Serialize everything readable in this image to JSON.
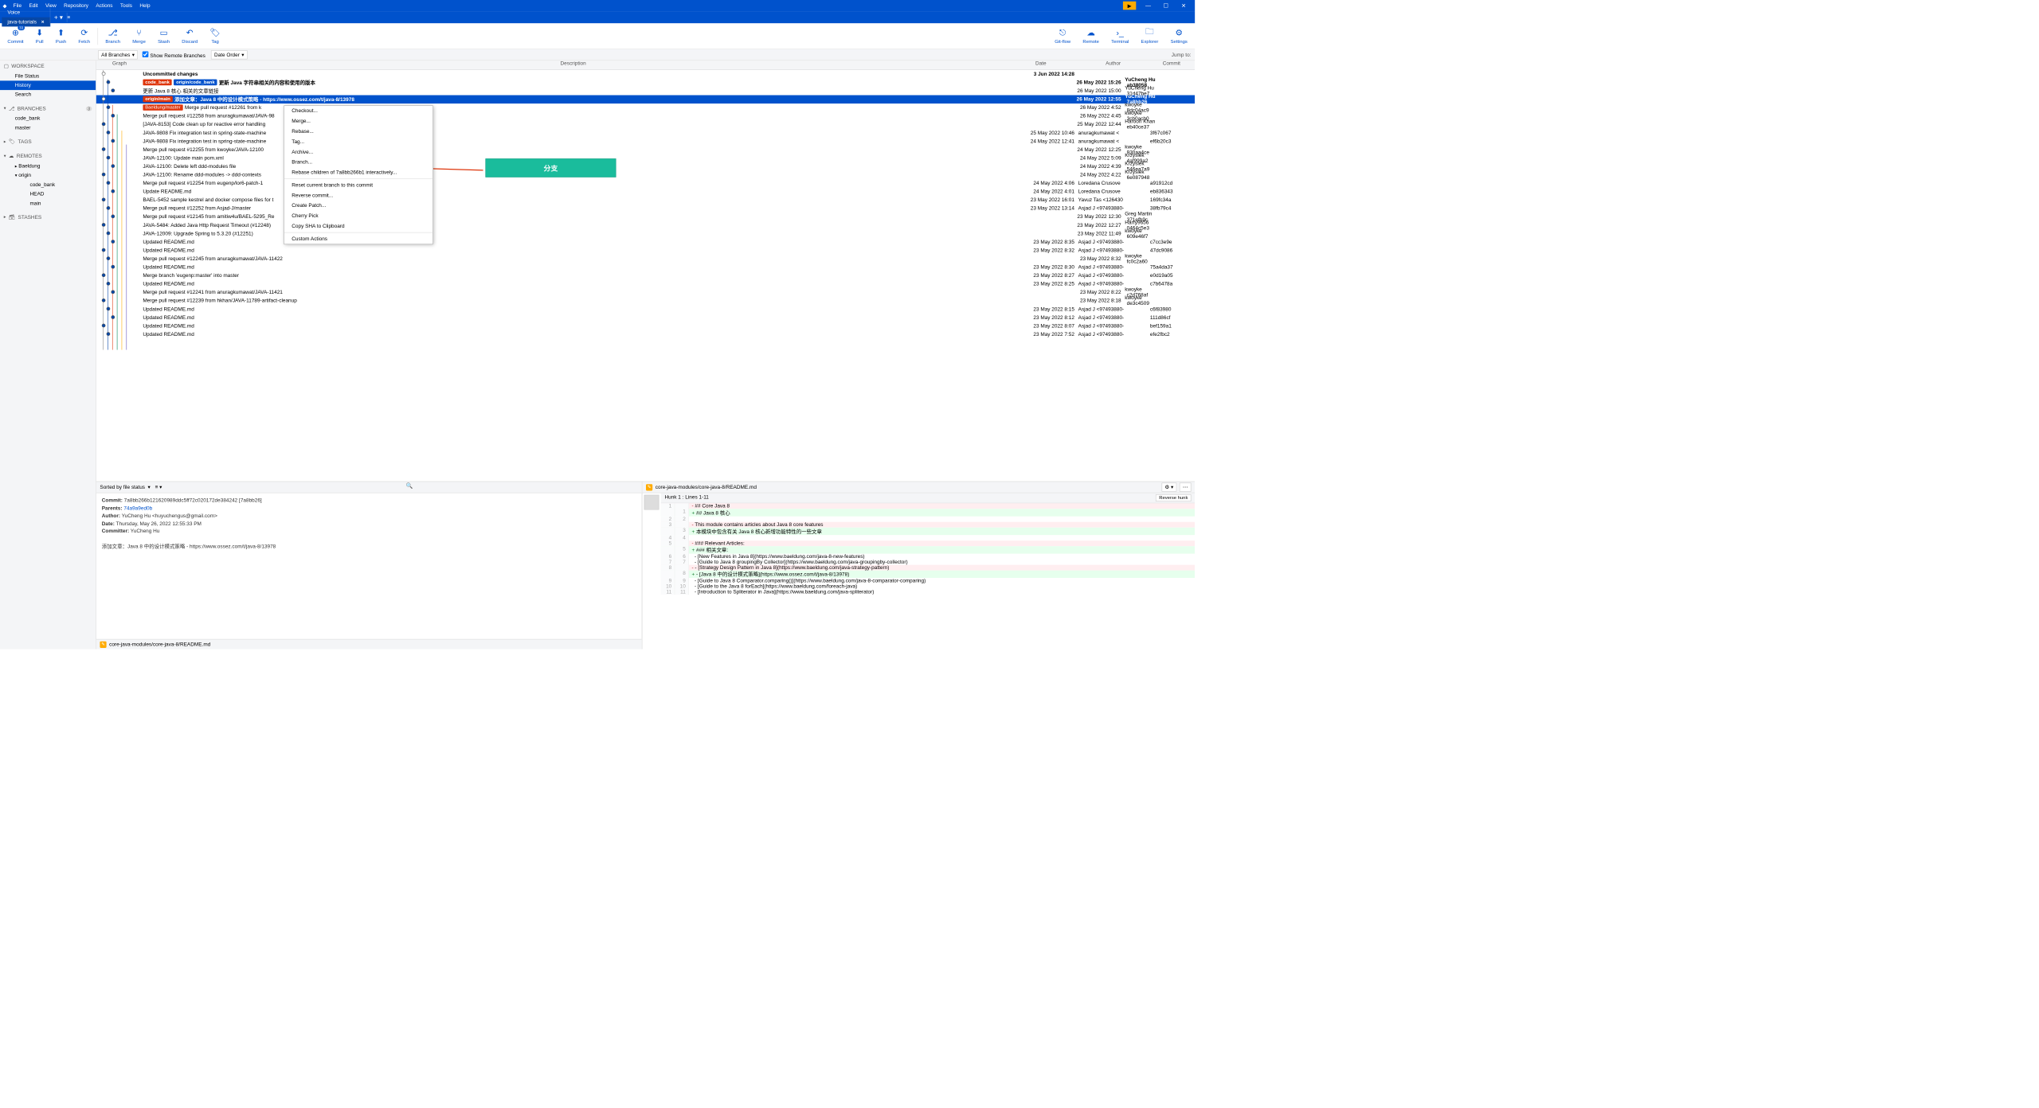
{
  "menus": [
    "File",
    "Edit",
    "View",
    "Repository",
    "Actions",
    "Tools",
    "Help"
  ],
  "tabs": [
    {
      "label": "Voice",
      "active": false
    },
    {
      "label": "java-tutorials",
      "active": true
    }
  ],
  "toolbar": {
    "commit": "Commit",
    "commit_badge": "33",
    "pull": "Pull",
    "push": "Push",
    "fetch": "Fetch",
    "branch": "Branch",
    "merge": "Merge",
    "stash": "Stash",
    "discard": "Discard",
    "tag": "Tag",
    "gitflow": "Git-flow",
    "remote": "Remote",
    "terminal": "Terminal",
    "explorer": "Explorer",
    "settings": "Settings"
  },
  "filters": {
    "all_branches": "All Branches",
    "show_remote": "Show Remote Branches",
    "date_order": "Date Order",
    "jump_to": "Jump to:"
  },
  "sidebar": {
    "workspace": "WORKSPACE",
    "file_status": "File Status",
    "history": "History",
    "search": "Search",
    "branches": "BRANCHES",
    "branches_badge": "3",
    "branch_items": [
      "code_bank",
      "master"
    ],
    "tags": "TAGS",
    "remotes": "REMOTES",
    "remote_items": [
      {
        "name": "Baeldung",
        "children": []
      },
      {
        "name": "origin",
        "children": [
          "code_bank",
          "HEAD",
          "main"
        ]
      }
    ],
    "stashes": "STASHES"
  },
  "columns": {
    "graph": "Graph",
    "description": "Description",
    "date": "Date",
    "author": "Author",
    "commit": "Commit"
  },
  "commits": [
    {
      "desc": "Uncommitted changes",
      "date": "3 Jun 2022 14:28",
      "author": "",
      "sha": "",
      "uncommitted": true
    },
    {
      "tags": [
        {
          "t": "code_bank",
          "c": "p"
        },
        {
          "t": "origin/code_bank",
          "c": "r"
        }
      ],
      "desc": "更新 Java 字符串相关的内容和使用的版本",
      "date": "26 May 2022 15:26",
      "author": "YuCheng Hu <huy",
      "sha": "ab38058",
      "bold": true
    },
    {
      "desc": "更新 Java 8 核心 相关的文章链接",
      "date": "26 May 2022 15:00",
      "author": "YuCheng Hu <huy",
      "sha": "31d47be7"
    },
    {
      "tags": [
        {
          "t": "origin/main",
          "c": "p"
        }
      ],
      "desc": "添加文章：Java 8 中的设计模式策略 - https://www.ossez.com/t/java-8/13978",
      "date": "26 May 2022 12:55",
      "author": "YuCheng Hu <huy",
      "sha": "7a8bb26",
      "selected": true,
      "bold": true
    },
    {
      "tags": [
        {
          "t": "Baeldung/master",
          "c": "p"
        }
      ],
      "desc": "Merge pull request #12261 from k",
      "date": "26 May 2022 4:52",
      "author": "kwoyke <krzysztof",
      "sha": "8dc04ac9"
    },
    {
      "desc": "Merge pull request #12258 from anuragkumawat/JAVA-98",
      "date": "26 May 2022 4:45",
      "author": "kwoyke <krzysztof",
      "sha": "3cb0acb0"
    },
    {
      "desc": "[JAVA-8153] Code clean up for reactive error handling",
      "date": "25 May 2022 12:44",
      "author": "Haroon Khan <har",
      "sha": "eb40ce37"
    },
    {
      "desc": "JAVA-9808 Fix integration test in spring-state-machine",
      "date": "25 May 2022 10:46",
      "author": "anuragkumawat <",
      "sha": "3f67c067"
    },
    {
      "desc": "JAVA-9808 Fix integration test in spring-state-machine",
      "date": "24 May 2022 12:41",
      "author": "anuragkumawat <",
      "sha": "ef6b20c3"
    },
    {
      "desc": "Merge pull request #12255 from kwoyke/JAVA-12100",
      "date": "24 May 2022 12:25",
      "author": "kwoyke <krzysztof",
      "sha": "930aa4ce"
    },
    {
      "desc": "JAVA-12100: Update main pom.xml",
      "date": "24 May 2022 5:09",
      "author": "Krzysiek <krzysztof",
      "sha": "4af999a2"
    },
    {
      "desc": "JAVA-12100: Delete left ddd-modules file",
      "date": "24 May 2022 4:39",
      "author": "Krzysiek <krzysztof",
      "sha": "546ea7a9"
    },
    {
      "desc": "JAVA-12100: Rename ddd-modules -> ddd-contexts",
      "date": "24 May 2022 4:22",
      "author": "Krzysiek <krzysztof",
      "sha": "6e087948"
    },
    {
      "desc": "Merge pull request #12254 from eugenp/lor6-patch-1",
      "date": "24 May 2022 4:06",
      "author": "Loredana Crusove",
      "sha": "a91912cd"
    },
    {
      "desc": "Update README.md",
      "date": "24 May 2022 4:01",
      "author": "Loredana Crusove",
      "sha": "eb836343"
    },
    {
      "desc": "BAEL-5452 sample kestrel and docker compose files for t",
      "date": "23 May 2022 16:01",
      "author": "Yavuz Tas <126430",
      "sha": "169fc34a"
    },
    {
      "desc": "Merge pull request #12252 from Asjad-J/master",
      "date": "23 May 2022 13:14",
      "author": "Asjad J <97493880-",
      "sha": "38fb79c4"
    },
    {
      "desc": "Merge pull request #12145 from amitiw4u/BAEL-5295_Re",
      "date": "23 May 2022 12:30",
      "author": "Greg Martin <greg",
      "sha": "371efb9c"
    },
    {
      "desc": "JAVA-5484: Added Java Http Request Timeout (#12248)",
      "date": "23 May 2022 12:27",
      "author": "Harry9656 <singha",
      "sha": "0464c5e3"
    },
    {
      "desc": "JAVA-12009: Upgrade Spring to 5.3.20 (#12251)",
      "date": "23 May 2022 11:49",
      "author": "kwoyke <krzysztof",
      "sha": "609e46f7"
    },
    {
      "desc": "Updated README.md",
      "date": "23 May 2022 8:35",
      "author": "Asjad J <97493880-",
      "sha": "c7cc3e9e"
    },
    {
      "desc": "Updated README.md",
      "date": "23 May 2022 8:32",
      "author": "Asjad J <97493880-",
      "sha": "47dc9086"
    },
    {
      "desc": "Merge pull request #12245 from anuragkumawat/JAVA-11422",
      "date": "23 May 2022 8:32",
      "author": "kwoyke <krzysztof",
      "sha": "fc0c2a60"
    },
    {
      "desc": "Updated README.md",
      "date": "23 May 2022 8:30",
      "author": "Asjad J <97493880-",
      "sha": "75a4da37"
    },
    {
      "desc": "Merge branch 'eugenp:master' into master",
      "date": "23 May 2022 8:27",
      "author": "Asjad J <97493880-",
      "sha": "e0d19a05"
    },
    {
      "desc": "Updated README.md",
      "date": "23 May 2022 8:25",
      "author": "Asjad J <97493880-",
      "sha": "c7b6478a"
    },
    {
      "desc": "Merge pull request #12241 from anuragkumawat/JAVA-11421",
      "date": "23 May 2022 8:22",
      "author": "kwoyke <krzysztof",
      "sha": "c2d768af"
    },
    {
      "desc": "Merge pull request #12239 from hkhan/JAVA-11789-artifact-cleanup",
      "date": "23 May 2022 8:18",
      "author": "kwoyke <krzysztof",
      "sha": "de3c4509"
    },
    {
      "desc": "Updated README.md",
      "date": "23 May 2022 8:15",
      "author": "Asjad J <97493880-",
      "sha": "c6f83980"
    },
    {
      "desc": "Updated README.md",
      "date": "23 May 2022 8:12",
      "author": "Asjad J <97493880-",
      "sha": "111d86cf"
    },
    {
      "desc": "Updated README.md",
      "date": "23 May 2022 8:07",
      "author": "Asjad J <97493880-",
      "sha": "bef159a1"
    },
    {
      "desc": "Updated README.md",
      "date": "23 May 2022 7:52",
      "author": "Asjad J <97493880-",
      "sha": "efe2fbc2"
    }
  ],
  "context_menu": {
    "items": [
      "Checkout...",
      "Merge...",
      "Rebase...",
      "Tag...",
      "Archive...",
      "Branch...",
      "Rebase children of 7a8bb266b1 interactively...",
      "-",
      "Reset current branch to this commit",
      "Reverse commit...",
      "Create Patch...",
      "Cherry Pick",
      "Copy SHA to Clipboard",
      "-",
      "Custom Actions"
    ]
  },
  "annotation": "分支",
  "sort_bar": "Sorted by file status",
  "details": {
    "commit_label": "Commit:",
    "commit_val": "7a8bb266b121620989ddc5ff72c020172de384242 [7a8bb26]",
    "parents_label": "Parents:",
    "parents_val": "74a9a9ed0b",
    "author_label": "Author:",
    "author_val": "YuCheng Hu <huyuchengus@gmail.com>",
    "date_label": "Date:",
    "date_val": "Thursday, May 26, 2022 12:55:33 PM",
    "committer_label": "Committer:",
    "committer_val": "YuCheng Hu",
    "message": "添加文章：Java 8 中的设计模式策略 - https://www.ossez.com/t/java-8/13978"
  },
  "changed_file": "core-java-modules/core-java-8/README.md",
  "diff": {
    "file_path": "core-java-modules/core-java-8/README.md",
    "hunk": "Hunk 1 : Lines 1-11",
    "reverse": "Reverse hunk",
    "lines": [
      {
        "ln1": "1",
        "ln2": "",
        "t": "del",
        "code": "## Core Java 8"
      },
      {
        "ln1": "",
        "ln2": "1",
        "t": "add",
        "code": "## Java 8 核心"
      },
      {
        "ln1": "2",
        "ln2": "2",
        "t": "ctx",
        "code": ""
      },
      {
        "ln1": "3",
        "ln2": "",
        "t": "del",
        "code": "This module contains articles about Java 8 core features"
      },
      {
        "ln1": "",
        "ln2": "3",
        "t": "add",
        "code": "本模块中包含有关 Java 8 核心新增功能特性的一些文章"
      },
      {
        "ln1": "4",
        "ln2": "4",
        "t": "ctx",
        "code": ""
      },
      {
        "ln1": "5",
        "ln2": "",
        "t": "del",
        "code": "### Relevant Articles:"
      },
      {
        "ln1": "",
        "ln2": "5",
        "t": "add",
        "code": "### 相关文章:"
      },
      {
        "ln1": "6",
        "ln2": "6",
        "t": "ctx",
        "code": "- [New Features in Java 8](https://www.baeldung.com/java-8-new-features)"
      },
      {
        "ln1": "7",
        "ln2": "7",
        "t": "ctx",
        "code": "- [Guide to Java 8 groupingBy Collector](https://www.baeldung.com/java-groupingby-collector)"
      },
      {
        "ln1": "8",
        "ln2": "",
        "t": "del",
        "code": "- [Strategy Design Pattern in Java 8](https://www.baeldung.com/java-strategy-pattern)"
      },
      {
        "ln1": "",
        "ln2": "8",
        "t": "add",
        "code": "- [Java 8 中的设计模式策略](https://www.ossez.com/t/java-8/13978)"
      },
      {
        "ln1": "9",
        "ln2": "9",
        "t": "ctx",
        "code": "- [Guide to Java 8 Comparator.comparing()](https://www.baeldung.com/java-8-comparator-comparing)"
      },
      {
        "ln1": "10",
        "ln2": "10",
        "t": "ctx",
        "code": "- [Guide to the Java 8 forEach](https://www.baeldung.com/foreach-java)"
      },
      {
        "ln1": "11",
        "ln2": "11",
        "t": "ctx",
        "code": "- [Introduction to Spliterator in Java](https://www.baeldung.com/java-spliterator)"
      }
    ]
  }
}
